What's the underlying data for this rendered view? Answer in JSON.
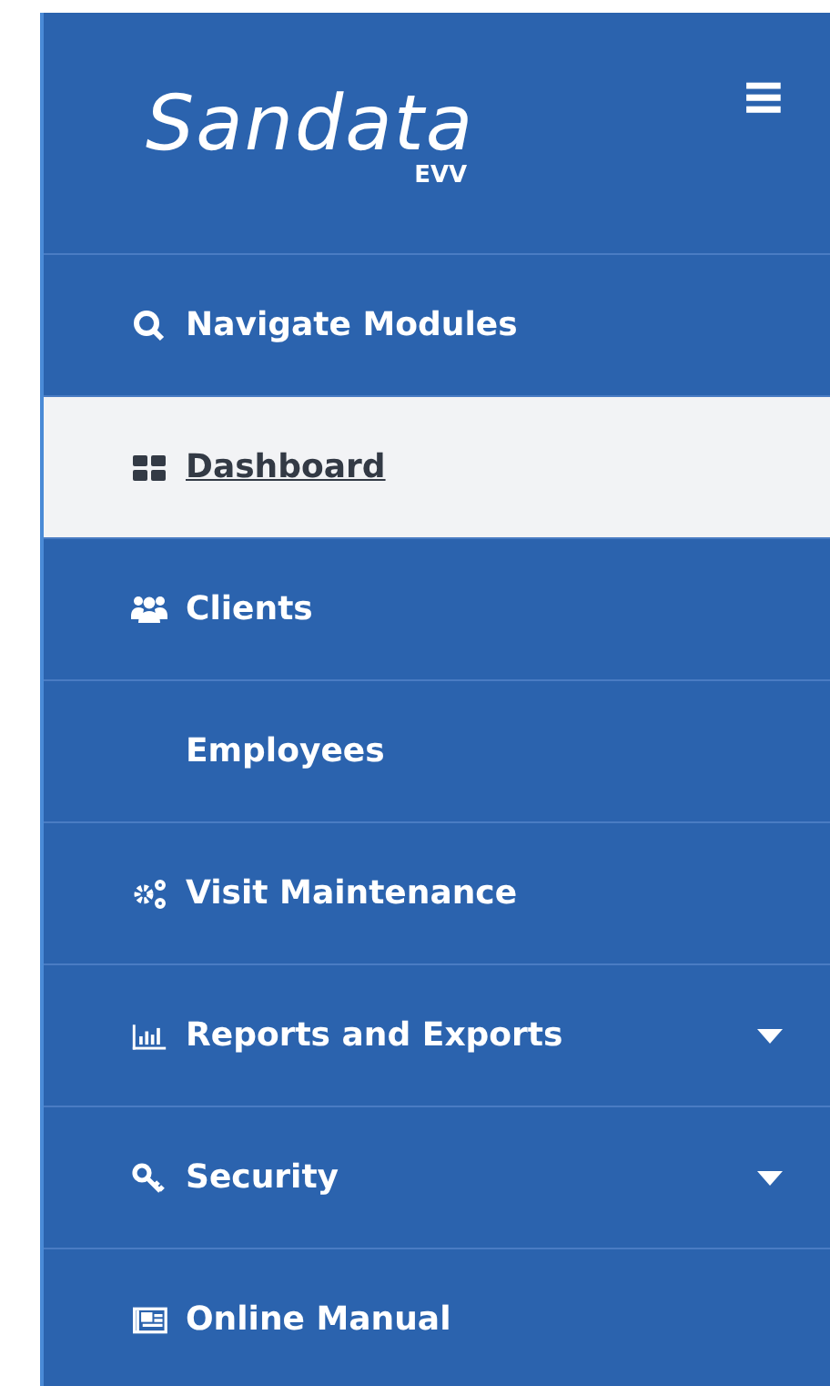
{
  "logo": {
    "name": "Sandata",
    "product": "EVV"
  },
  "menu_button": {
    "label": "≡"
  },
  "nav_items": [
    {
      "label": "Navigate Modules",
      "selected": false,
      "expandable": false
    },
    {
      "label": "Dashboard",
      "selected": true,
      "expandable": false
    },
    {
      "label": "Clients",
      "selected": false,
      "expandable": false
    },
    {
      "label": "Employees",
      "selected": false,
      "expandable": false
    },
    {
      "label": "Visit Maintenance",
      "selected": false,
      "expandable": false
    },
    {
      "label": "Reports and Exports",
      "selected": false,
      "expandable": true
    },
    {
      "label": "Security",
      "selected": false,
      "expandable": true
    },
    {
      "label": "Online Manual",
      "selected": false,
      "expandable": false
    }
  ]
}
